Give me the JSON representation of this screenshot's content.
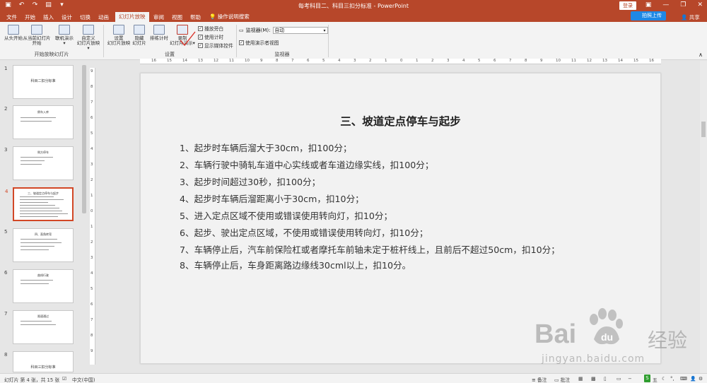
{
  "titlebar": {
    "title": "每考科目二、科目三扣分标准 - PowerPoint",
    "login": "登录",
    "qat": [
      "save-icon",
      "undo-icon",
      "redo-icon",
      "present-icon",
      "dropdown-icon"
    ]
  },
  "tabs": [
    {
      "label": "文件"
    },
    {
      "label": "开始"
    },
    {
      "label": "插入"
    },
    {
      "label": "设计"
    },
    {
      "label": "切换"
    },
    {
      "label": "动画"
    },
    {
      "label": "幻灯片放映",
      "active": true
    },
    {
      "label": "审阅"
    },
    {
      "label": "视图"
    },
    {
      "label": "帮助"
    }
  ],
  "tellme": "操作说明搜索",
  "upload": "拍照上传",
  "share": "共享",
  "ribbon": {
    "start_group": {
      "label": "开始放映幻灯片",
      "from_start": "从头开始",
      "from_current_line1": "从当前幻灯片",
      "from_current_line2": "开始",
      "online_line1": "联机演示",
      "custom_line1": "自定义",
      "custom_line2": "幻灯片放映"
    },
    "setup_group": {
      "label": "设置",
      "setup_line1": "设置",
      "setup_line2": "幻灯片放映",
      "hide_line1": "隐藏",
      "hide_line2": "幻灯片",
      "rehearse": "排练计时",
      "record_line1": "录制",
      "record_line2": "幻灯片演示",
      "play_narration": "播放旁白",
      "use_timings": "使用计时",
      "show_media": "显示媒体控件"
    },
    "monitor_group": {
      "label": "监视器",
      "monitor_label": "监视器(M):",
      "monitor_value": "自动",
      "presenter_view": "使用演示者视图"
    }
  },
  "slides": [
    {
      "num": "1",
      "title": "科目二扣分标准"
    },
    {
      "num": "2",
      "title": "倒车入库"
    },
    {
      "num": "3",
      "title": "侧方停车"
    },
    {
      "num": "4",
      "title": "三、坡道定点停车与起步",
      "active": true
    },
    {
      "num": "5",
      "title": "四、直角转弯"
    },
    {
      "num": "6",
      "title": "曲线行驶"
    },
    {
      "num": "7",
      "title": "限速通过"
    },
    {
      "num": "8",
      "title": "科目三扣分标准"
    }
  ],
  "hruler": [
    "16",
    "15",
    "14",
    "13",
    "12",
    "11",
    "10",
    "9",
    "8",
    "7",
    "6",
    "5",
    "4",
    "3",
    "2",
    "1",
    "0",
    "1",
    "2",
    "3",
    "4",
    "5",
    "6",
    "7",
    "8",
    "9",
    "10",
    "11",
    "12",
    "13",
    "14",
    "15",
    "16"
  ],
  "vruler": [
    "9",
    "8",
    "7",
    "6",
    "5",
    "4",
    "3",
    "2",
    "1",
    "0",
    "1",
    "2",
    "3",
    "4",
    "5",
    "6",
    "7",
    "8",
    "9"
  ],
  "slide": {
    "title": "三、坡道定点停车与起步",
    "items": [
      "1、起步时车辆后溜大于30cm，扣100分；",
      "2、车辆行驶中骑轧车道中心实线或者车道边缘实线，扣100分；",
      "3、起步时间超过30秒，扣100分；",
      "4、起步时车辆后溜距离小于30cm，扣10分；",
      "5、进入定点区域不使用或错误使用转向灯，扣10分；",
      "6、起步、驶出定点区域，不使用或错误使用转向灯，扣10分；",
      "7、车辆停止后，汽车前保险杠或者摩托车前轴未定于桩杆线上，且前后不超过50cm，扣10分；",
      "8、车辆停止后，车身距离路边缘线30cml以上，扣10分。"
    ]
  },
  "watermark": {
    "brand": "Bai",
    "brand2": "经验",
    "url": "jingyan.baidu.com"
  },
  "status": {
    "slide_of": "幻灯片 第 4 张，共 15 张",
    "language": "中文(中国)",
    "notes": "备注",
    "comments": "批注",
    "ime": "S",
    "ime_text": "五"
  },
  "colors": {
    "accent": "#b7472a",
    "active_thumb": "#d24726"
  }
}
